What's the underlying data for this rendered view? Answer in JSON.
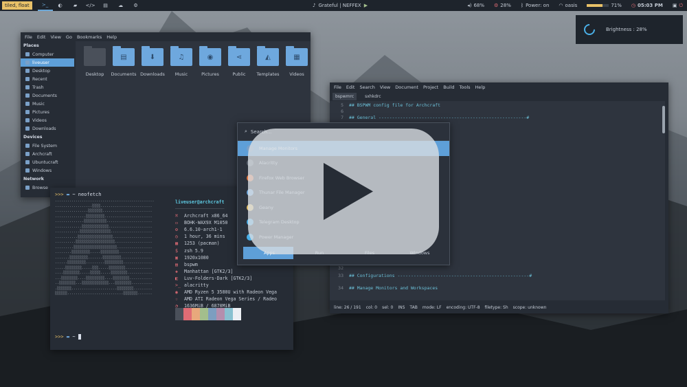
{
  "topbar": {
    "layout": "tiled, float",
    "workspaces": [
      "≻_",
      "◐",
      "▰",
      "</>",
      "▤",
      "☁",
      "⚙"
    ],
    "song": "Grateful | NEFFEX",
    "volume": "68%",
    "cpu": "28%",
    "bluetooth": "Power: on",
    "wifi": "oasis",
    "battery": "71%",
    "battery_level": 0.71,
    "clock": "05:03 PM",
    "accent": "#e8c168"
  },
  "brightness": {
    "label": "Brightness : 28%"
  },
  "file_manager": {
    "menu": [
      "File",
      "Edit",
      "View",
      "Go",
      "Bookmarks",
      "Help"
    ],
    "sections": [
      {
        "title": "Places",
        "items": [
          "Computer",
          "liveuser",
          "Desktop",
          "Recent",
          "Trash",
          "Documents",
          "Music",
          "Pictures",
          "Videos",
          "Downloads"
        ]
      },
      {
        "title": "Devices",
        "items": [
          "File System",
          "Archcraft",
          "Ubuntucraft",
          "Windows"
        ]
      },
      {
        "title": "Network",
        "items": [
          "Browse"
        ]
      }
    ],
    "active_item": "liveuser",
    "folders": [
      "Desktop",
      "Documents",
      "Downloads",
      "Music",
      "Pictures",
      "Public",
      "Templates",
      "Videos"
    ],
    "folder_icons": [
      "desktop",
      "document",
      "download",
      "music",
      "camera",
      "share",
      "template",
      "video"
    ]
  },
  "geany": {
    "menu": [
      "File",
      "Edit",
      "Search",
      "View",
      "Document",
      "Project",
      "Build",
      "Tools",
      "Help"
    ],
    "tabs": [
      "bspwmrc",
      "sxhkdrc"
    ],
    "lines": [
      {
        "n": "5",
        "t": "## BSPWM config file for Archcraft"
      },
      {
        "n": "6",
        "t": ""
      },
      {
        "n": "7",
        "t": "## General -------------------------------------------------------#"
      },
      {
        "n": "31",
        "t": "BSPWM_CENTER=\"0.50\""
      },
      {
        "n": "32",
        "t": ""
      },
      {
        "n": "33",
        "t": "## Configurations -------------------------------------------------#"
      },
      {
        "n": "34",
        "t": "## Manage Monitors and Workspaces"
      }
    ],
    "status": [
      "line: 26 / 191",
      "col: 0",
      "sel: 0",
      "INS",
      "TAB",
      "mode: LF",
      "encoding: UTF-8",
      "filetype: Sh",
      "scope: unknown"
    ]
  },
  "terminal": {
    "prompt_arrows": ">>>",
    "command": "neofetch",
    "user_host": "liveuser@archcraft",
    "info": [
      {
        "icon": "⌘",
        "value": "Archcraft x86_64"
      },
      {
        "icon": "▭",
        "value": "BOHK-WAX9X M1050"
      },
      {
        "icon": "⚙",
        "value": "6.6.10-arch1-1"
      },
      {
        "icon": "◷",
        "value": "1 hour, 36 mins"
      },
      {
        "icon": "▦",
        "value": "1253 (pacman)"
      },
      {
        "icon": "$",
        "value": "zsh 5.9"
      },
      {
        "icon": "▣",
        "value": "1920x1080"
      },
      {
        "icon": "▤",
        "value": "bspwm"
      },
      {
        "icon": "◈",
        "value": "Manhattan [GTK2/3]"
      },
      {
        "icon": "◧",
        "value": "Luv-Folders-Dark [GTK2/3]"
      },
      {
        "icon": ">_",
        "value": "alacritty"
      },
      {
        "icon": "◉",
        "value": "AMD Ryzen 5 3580U with Radeon Vega"
      },
      {
        "icon": "☆",
        "value": "AMD ATI Radeon Vega Series / Radeo"
      },
      {
        "icon": "◔",
        "value": "1636MiB / 6870MiB"
      }
    ],
    "palette": [
      "#4a505a",
      "#e06c75",
      "#e8a87c",
      "#a3be8c",
      "#7d9ec0",
      "#b48ead",
      "#88c0d0",
      "#eceff4"
    ]
  },
  "launcher": {
    "search_label": "Search...",
    "items": [
      {
        "label": "Manage Monitors",
        "color": "#7aa0c8"
      },
      {
        "label": "Alacritty",
        "color": "#5c6470"
      },
      {
        "label": "Firefox Web Browser",
        "color": "#e8763c"
      },
      {
        "label": "Thunar File Manager",
        "color": "#6ea8de"
      },
      {
        "label": "Geany",
        "color": "#e8c168"
      },
      {
        "label": "Telegram Desktop",
        "color": "#4ab0e8"
      },
      {
        "label": "Power Manager",
        "color": "#4ab0e8"
      }
    ],
    "modes": [
      "Apps",
      "Run",
      "Files",
      "Windows"
    ]
  }
}
